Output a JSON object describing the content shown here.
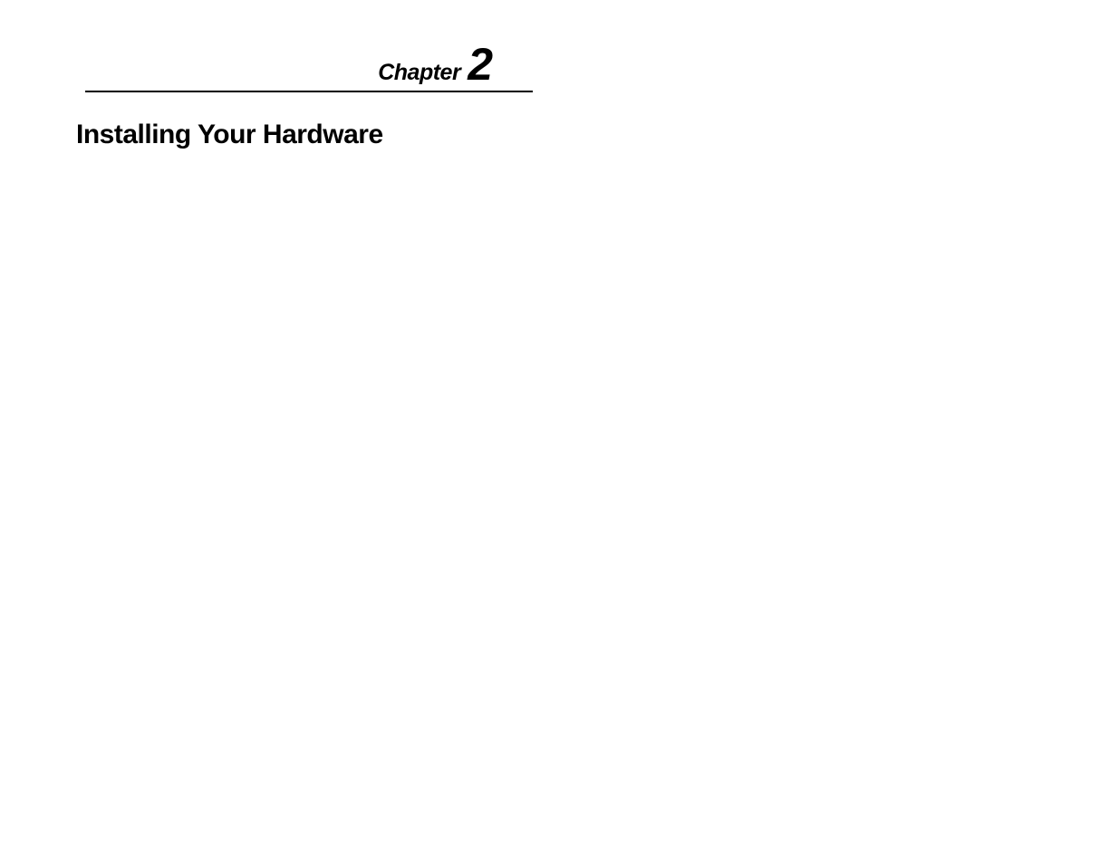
{
  "chapter": {
    "label": "Chapter",
    "number": "2"
  },
  "section": {
    "title": "Installing Your Hardware"
  }
}
